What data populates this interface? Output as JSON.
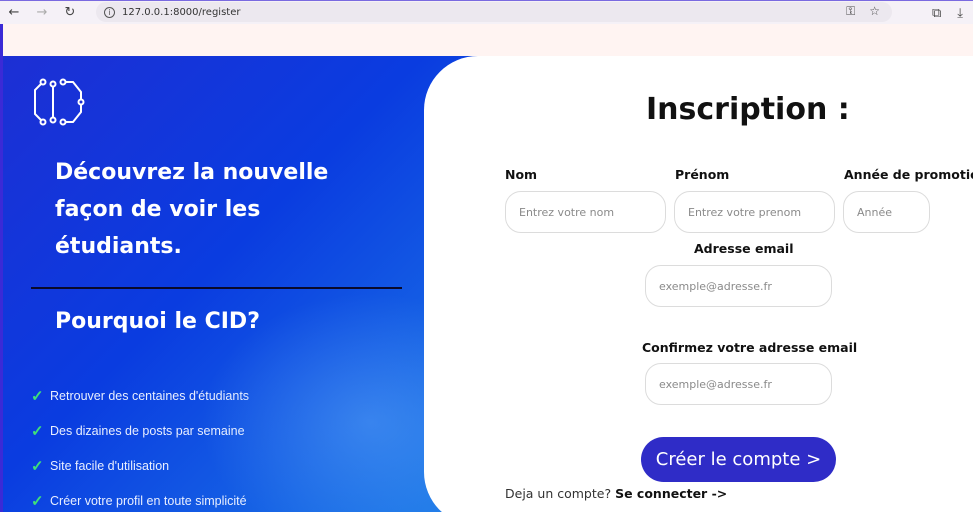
{
  "browser": {
    "url": "127.0.0.1:8000/register"
  },
  "left": {
    "headline": "Découvrez la nouvelle façon de voir les étudiants.",
    "why_title": "Pourquoi le CID?",
    "features": [
      "Retrouver des centaines d'étudiants",
      "Des dizaines de posts par semaine",
      "Site facile d'utilisation",
      "Créer votre profil en toute simplicité"
    ]
  },
  "form": {
    "title": "Inscription :",
    "nom_label": "Nom",
    "nom_placeholder": "Entrez votre nom",
    "prenom_label": "Prénom",
    "prenom_placeholder": "Entrez votre prenom",
    "annee_label": "Année de promotion",
    "annee_placeholder": "Année",
    "email_label": "Adresse email",
    "email_placeholder": "exemple@adresse.fr",
    "confirm_label": "Confirmez votre adresse email",
    "confirm_placeholder": "exemple@adresse.fr",
    "submit_label": "Créer le compte >",
    "login_prompt": "Deja un compte?",
    "login_link": "Se connecter ->"
  },
  "colors": {
    "brand_blue": "#1d2fd4",
    "button": "#2f2cc7",
    "check": "#3fe07a"
  }
}
